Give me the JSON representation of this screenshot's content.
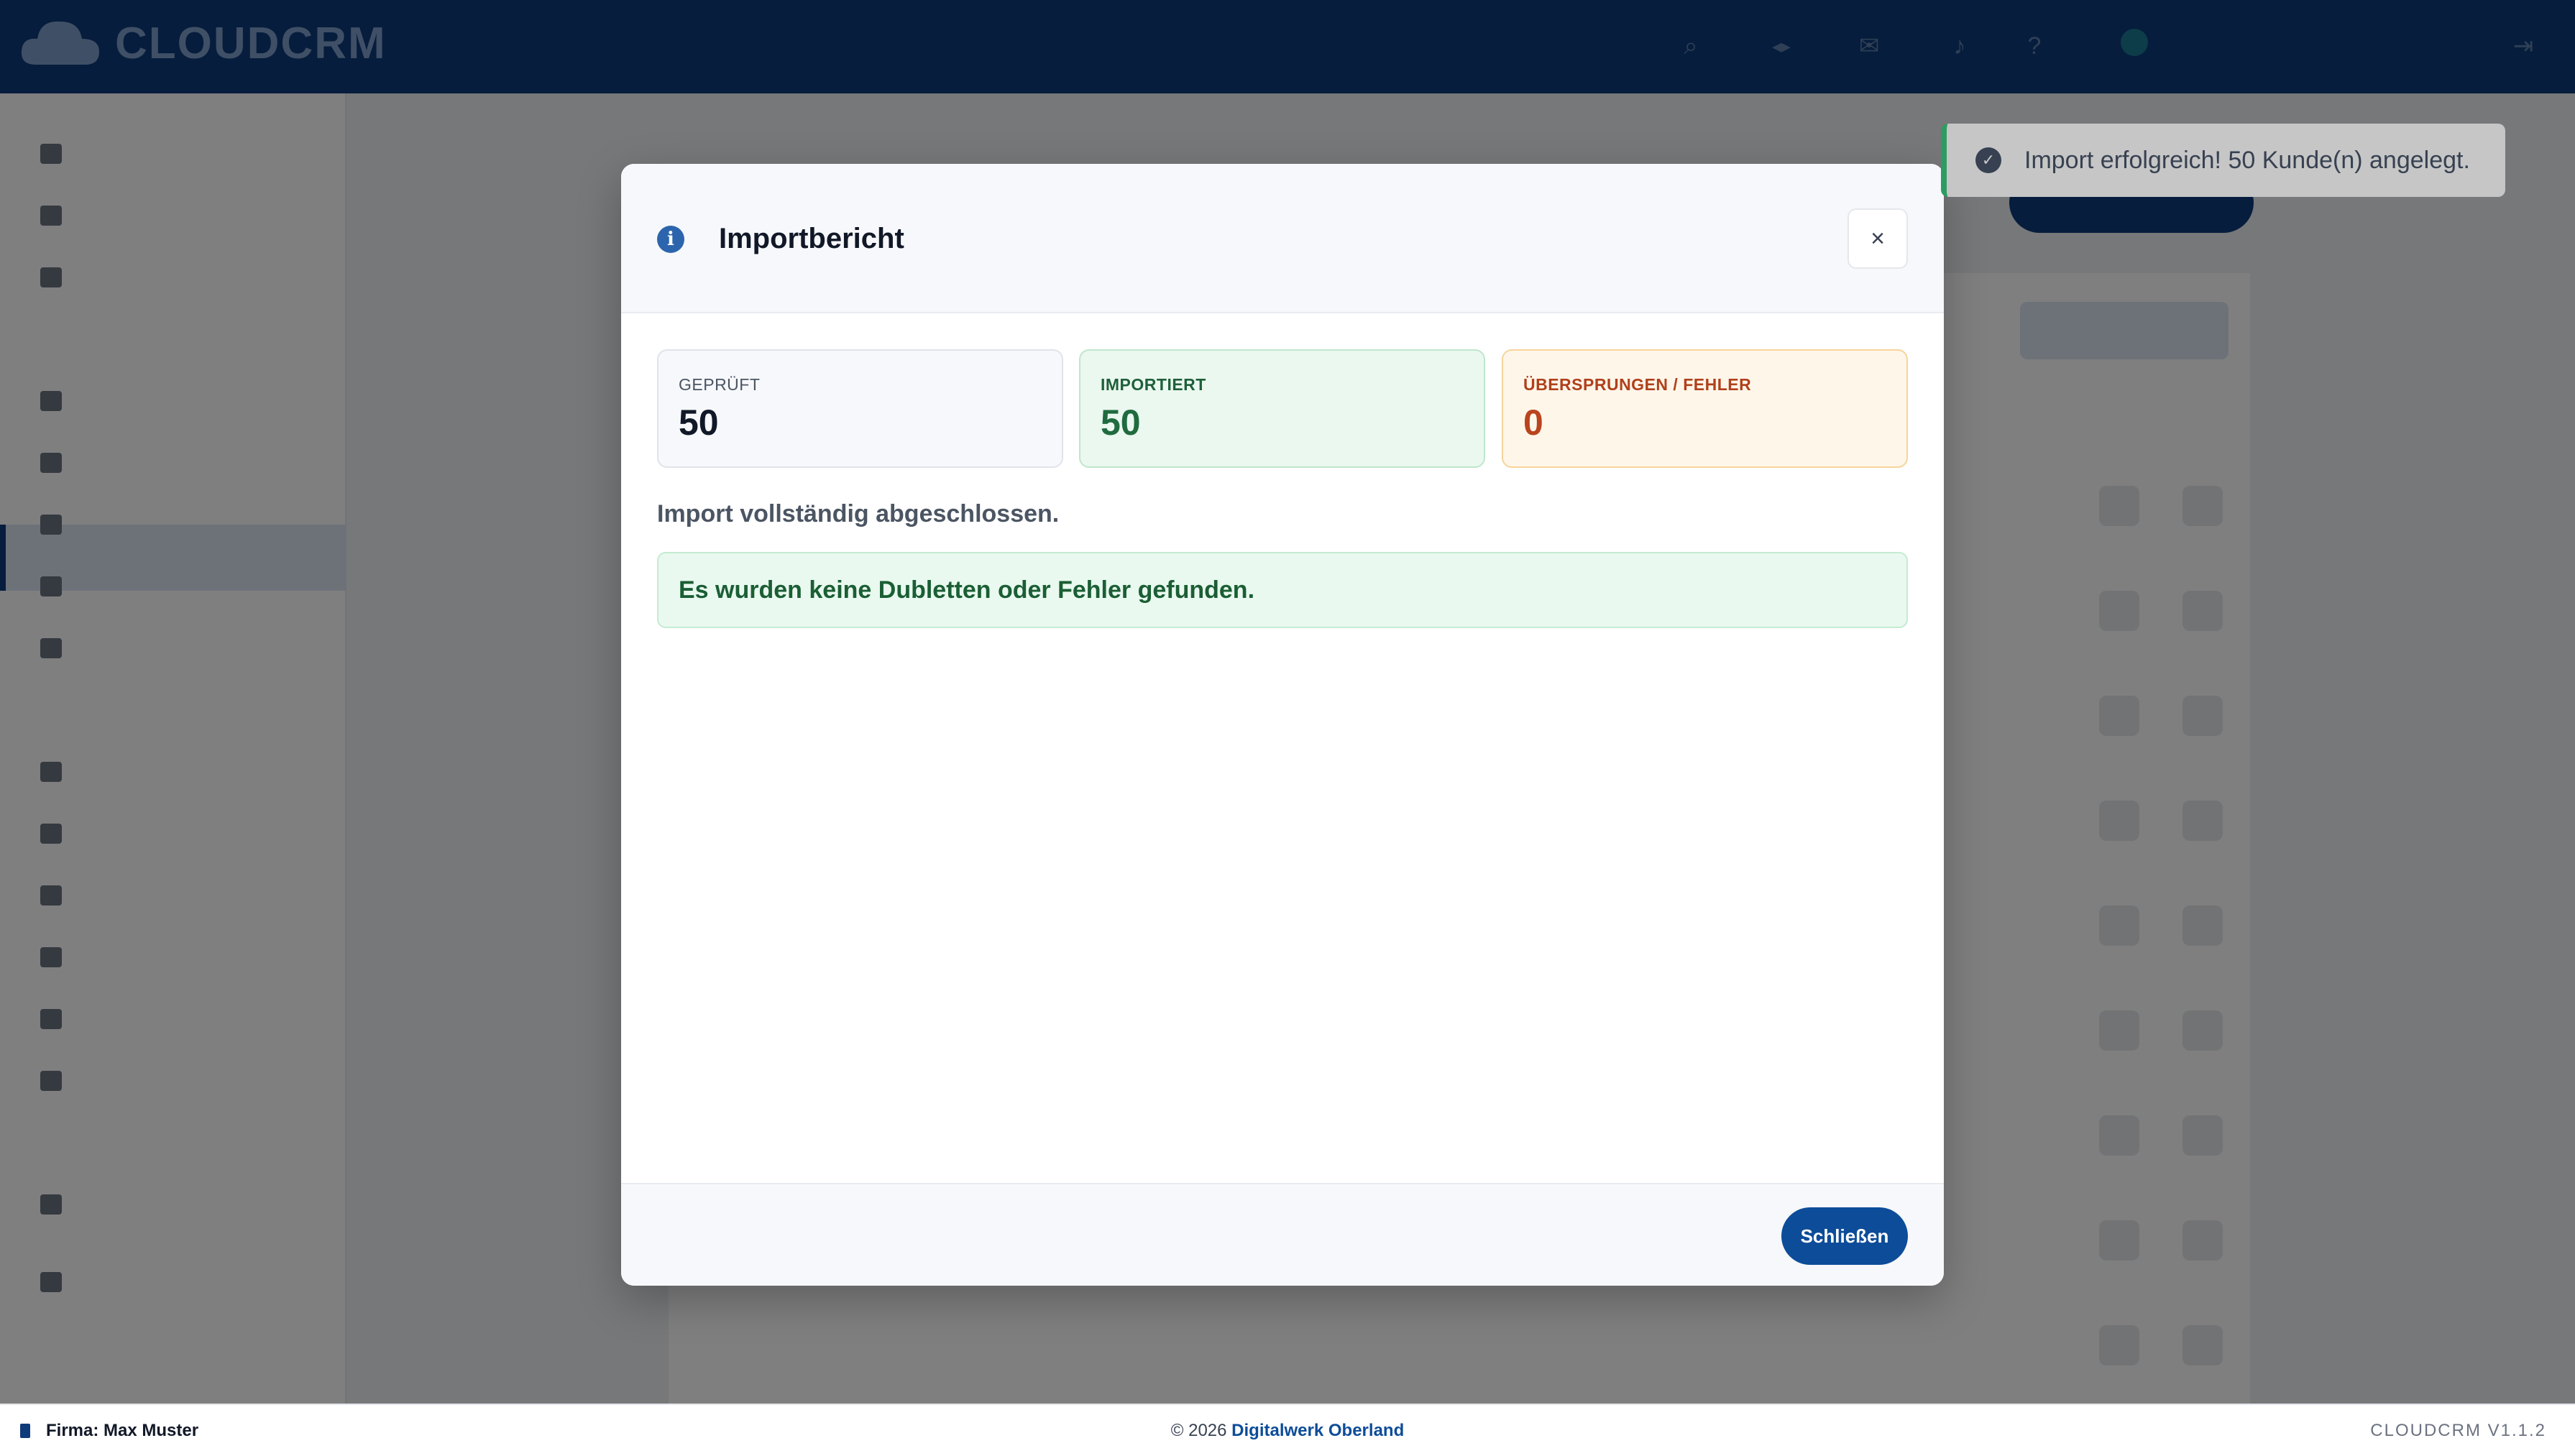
{
  "app": {
    "logo_text": "CLOUDCRM"
  },
  "modal": {
    "title": "Importbericht",
    "close_symbol": "×",
    "stats": {
      "checked": {
        "label": "GEPRÜFT",
        "value": "50"
      },
      "imported": {
        "label": "IMPORTIERT",
        "value": "50"
      },
      "skipped": {
        "label": "ÜBERSPRUNGEN / FEHLER",
        "value": "0"
      }
    },
    "summary": "Import vollständig abgeschlossen.",
    "success_message": "Es wurden keine Dubletten oder Fehler gefunden.",
    "close_button": "Schließen"
  },
  "toast": {
    "message": "Import erfolgreich! 50 Kunde(n) angelegt."
  },
  "footer": {
    "company": "Firma: Max Muster",
    "copyright_prefix": "© 2026 ",
    "copyright_link": "Digitalwerk Oberland",
    "version": "CLOUDCRM V1.1.2"
  },
  "colors": {
    "brand": "#0d3b7a",
    "primary_button": "#0d4c99",
    "success": "#1b5e34",
    "warning": "#b9441d"
  },
  "icons": [
    "info-icon",
    "close-icon",
    "check-circle-icon",
    "building-icon"
  ]
}
